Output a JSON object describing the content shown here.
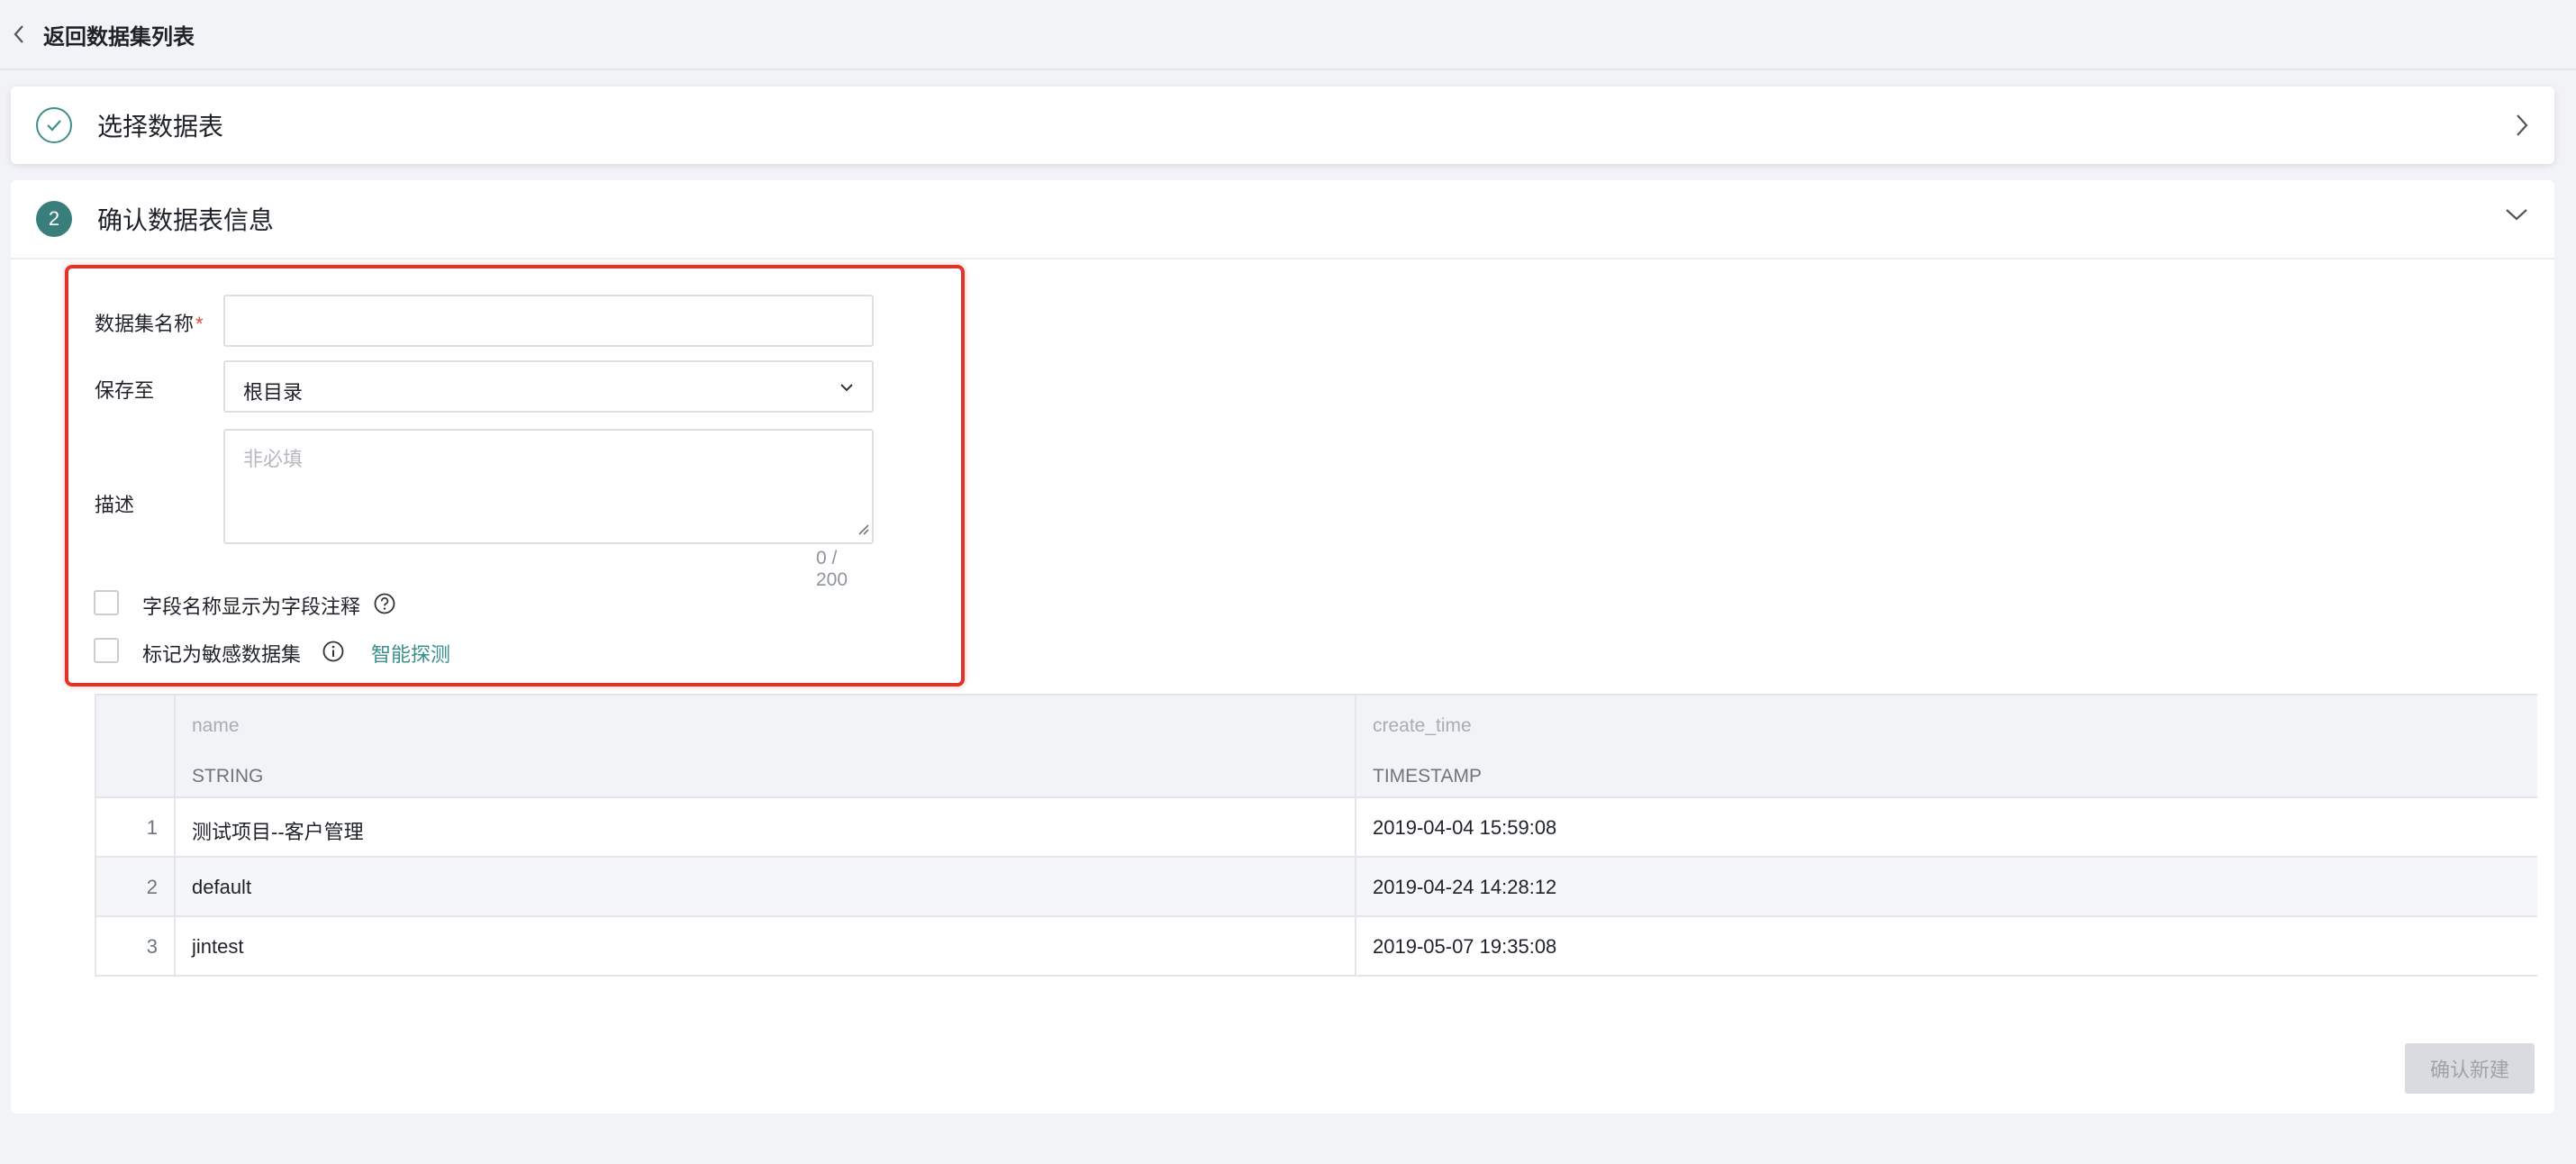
{
  "header": {
    "back_label": "返回数据集列表"
  },
  "steps": {
    "step1": {
      "title": "选择数据表"
    },
    "step2": {
      "number": "2",
      "title": "确认数据表信息"
    }
  },
  "form": {
    "name_label": "数据集名称",
    "required_mark": "*",
    "name_value": "",
    "save_label": "保存至",
    "save_value": "根目录",
    "desc_label": "描述",
    "desc_placeholder": "非必填",
    "desc_counter": "0 / 200",
    "option_comment_label": "字段名称显示为字段注释",
    "option_sensitive_label": "标记为敏感数据集",
    "smart_detect_link": "智能探测"
  },
  "table": {
    "columns": [
      {
        "name": "name",
        "type": "STRING"
      },
      {
        "name": "create_time",
        "type": "TIMESTAMP"
      }
    ],
    "rows": [
      {
        "index": "1",
        "name": "测试项目--客户管理",
        "create_time": "2019-04-04 15:59:08"
      },
      {
        "index": "2",
        "name": "default",
        "create_time": "2019-04-24 14:28:12"
      },
      {
        "index": "3",
        "name": "jintest",
        "create_time": "2019-05-07 19:35:08"
      }
    ]
  },
  "actions": {
    "confirm_label": "确认新建"
  },
  "colors": {
    "accent": "#3a7e7b",
    "link": "#3a8f8b",
    "highlight": "#e0342a",
    "required": "#e5483a"
  }
}
